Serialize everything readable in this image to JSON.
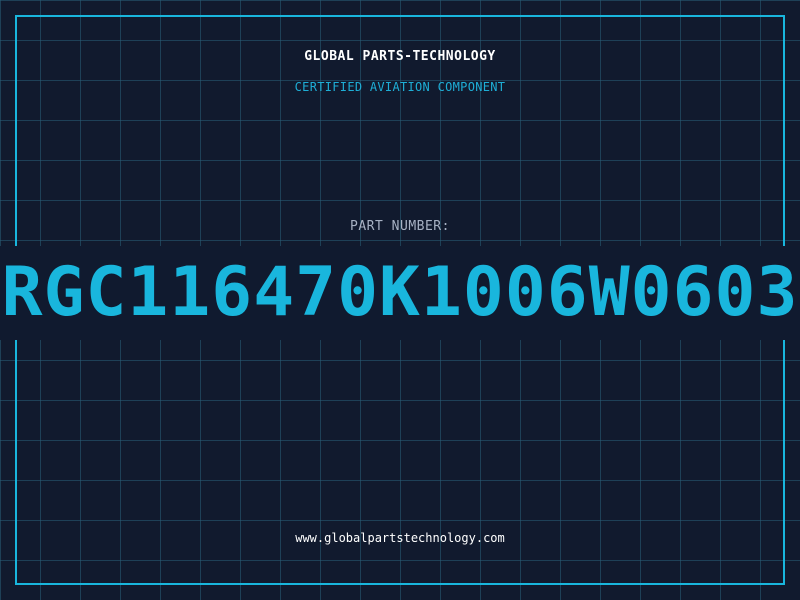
{
  "header": {
    "company": "GLOBAL PARTS-TECHNOLOGY",
    "subtitle": "CERTIFIED AVIATION COMPONENT"
  },
  "part": {
    "label": "PART NUMBER:",
    "number": "RGC116470K1006W0603"
  },
  "footer": {
    "website": "www.globalpartstechnology.com"
  },
  "colors": {
    "background": "#111a2e",
    "accent": "#19b6dd",
    "grid": "#285f78",
    "label": "#a8b2c4",
    "text": "#ffffff"
  }
}
